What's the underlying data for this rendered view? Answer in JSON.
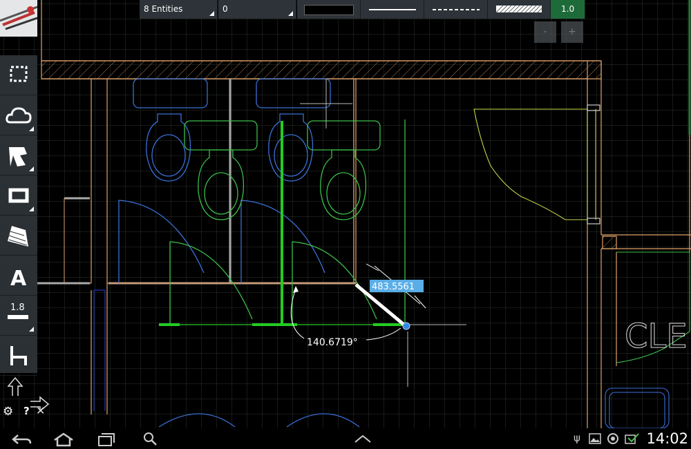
{
  "toolbar": {
    "entities_label": "8 Entities",
    "layer_label": "0",
    "scale_value": "1.0",
    "zoom_out_label": "-",
    "zoom_in_label": "+"
  },
  "left_tools": [
    {
      "icon": "select-rectangle-icon"
    },
    {
      "icon": "cloud-icon"
    },
    {
      "icon": "polyline-icon"
    },
    {
      "icon": "rectangle-icon"
    },
    {
      "icon": "hatch-icon"
    },
    {
      "icon": "text-icon"
    },
    {
      "icon": "line-weight-icon",
      "label": "1.8"
    },
    {
      "icon": "dimension-icon"
    }
  ],
  "bottom_tools": {
    "settings_icon": "gear-icon",
    "help_label": "?",
    "close_icon": "close-icon"
  },
  "drawing": {
    "dimension_value": "483.5561",
    "angle_value": "140.6719°",
    "text_fragment": "CLE"
  },
  "status_bar": {
    "time": "14:02"
  },
  "colors": {
    "toolbar_bg": "#2d3338",
    "active_green": "#1e6b3a",
    "grid": "#2f3a2f",
    "wall": "#e3a36a",
    "fixture_blue": "#3b6fd6",
    "fixture_green": "#3cbf4a",
    "highlight": "#5aaee8"
  }
}
